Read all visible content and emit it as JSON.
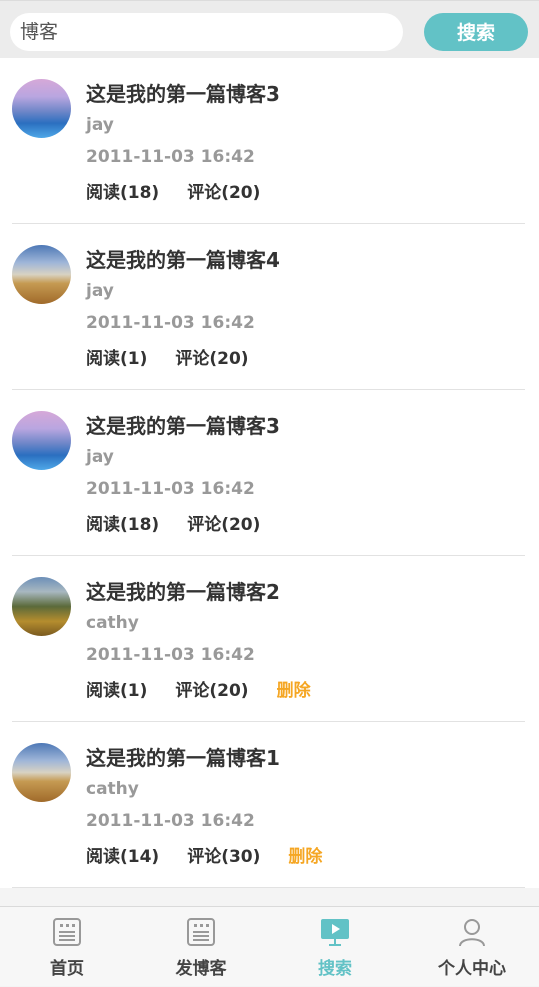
{
  "search": {
    "value": "博客",
    "button_label": "搜索"
  },
  "posts": [
    {
      "title": "这是我的第一篇博客3",
      "author": "jay",
      "date": "2011-11-03 16:42",
      "reads": "阅读(18)",
      "comments": "评论(20)",
      "delete_label": "",
      "avatar": "pink-sunset-photo"
    },
    {
      "title": "这是我的第一篇博客4",
      "author": "jay",
      "date": "2011-11-03 16:42",
      "reads": "阅读(1)",
      "comments": "评论(20)",
      "delete_label": "",
      "avatar": "desert-photo"
    },
    {
      "title": "这是我的第一篇博客3",
      "author": "jay",
      "date": "2011-11-03 16:42",
      "reads": "阅读(18)",
      "comments": "评论(20)",
      "delete_label": "",
      "avatar": "pink-sunset-photo"
    },
    {
      "title": "这是我的第一篇博客2",
      "author": "cathy",
      "date": "2011-11-03 16:42",
      "reads": "阅读(1)",
      "comments": "评论(20)",
      "delete_label": "删除",
      "avatar": "valley-photo"
    },
    {
      "title": "这是我的第一篇博客1",
      "author": "cathy",
      "date": "2011-11-03 16:42",
      "reads": "阅读(14)",
      "comments": "评论(30)",
      "delete_label": "删除",
      "avatar": "desert-photo"
    }
  ],
  "nav": {
    "items": [
      {
        "label": "首页",
        "icon": "newspaper-icon"
      },
      {
        "label": "发博客",
        "icon": "newspaper-icon"
      },
      {
        "label": "搜索",
        "icon": "play-screen-icon"
      },
      {
        "label": "个人中心",
        "icon": "person-icon"
      }
    ],
    "active_color": "#62c2c6"
  },
  "colors": {
    "accent": "#62c2c6",
    "delete": "#f5a623"
  }
}
